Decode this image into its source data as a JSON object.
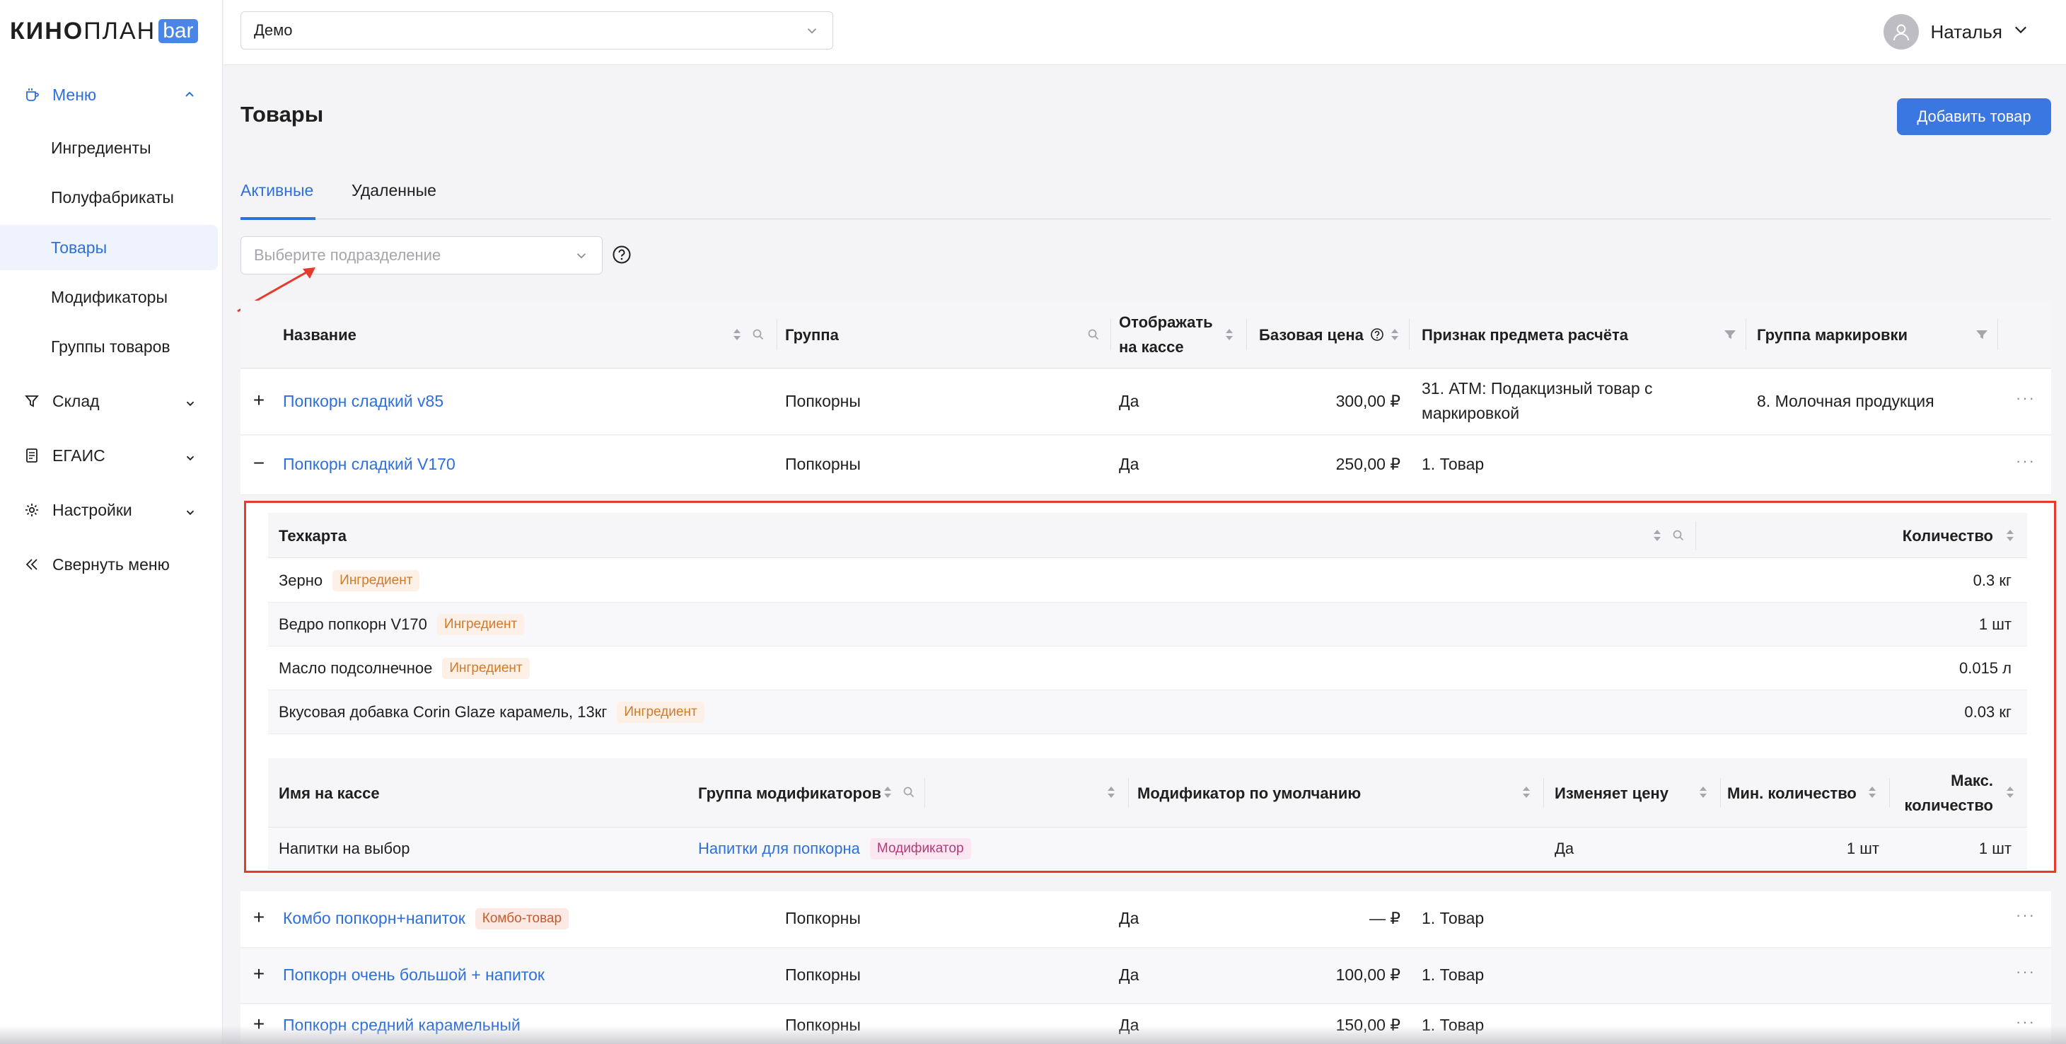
{
  "logo": {
    "prefix": "КИНО",
    "main": "ПЛАН",
    "badge": "bar"
  },
  "sidebar": {
    "menu_label": "Меню",
    "sub_items": [
      {
        "label": "Ингредиенты"
      },
      {
        "label": "Полуфабрикаты"
      },
      {
        "label": "Товары"
      },
      {
        "label": "Модификаторы"
      },
      {
        "label": "Группы товаров"
      }
    ],
    "main_items": [
      {
        "label": "Склад",
        "icon": "funnel-icon"
      },
      {
        "label": "ЕГАИС",
        "icon": "document-icon"
      },
      {
        "label": "Настройки",
        "icon": "gear-icon"
      },
      {
        "label": "Свернуть меню",
        "icon": "double-chevron-left-icon"
      }
    ],
    "active_item": "Товары"
  },
  "header": {
    "cinema_select": "Демо",
    "user_name": "Наталья"
  },
  "page": {
    "title": "Товары",
    "add_button": "Добавить товар",
    "tabs": [
      {
        "label": "Активные"
      },
      {
        "label": "Удаленные"
      }
    ],
    "subdivision_placeholder": "Выберите подразделение"
  },
  "colors": {
    "accent": "#3b77e0",
    "highlight_border": "#e53a2e",
    "arrow": "#e53a2e"
  },
  "table": {
    "columns": {
      "name": "Название",
      "group": "Группа",
      "show_line1": "Отображать",
      "show_line2": "на кассе",
      "price": "Базовая цена",
      "sign": "Признак предмета расчёта",
      "marking": "Группа маркировки"
    },
    "rows": [
      {
        "expander": "+",
        "name": "Попкорн сладкий v85",
        "badge": "",
        "group": "Попкорны",
        "show": "Да",
        "price": "300,00 ₽",
        "sign_line1": "31. АТМ: Подакцизный товар с",
        "sign_line2": "маркировкой",
        "marking": "8. Молочная продукция"
      },
      {
        "expander": "−",
        "name": "Попкорн сладкий V170",
        "badge": "",
        "group": "Попкорны",
        "show": "Да",
        "price": "250,00 ₽",
        "sign_line1": "1. Товар",
        "sign_line2": "",
        "marking": ""
      },
      {
        "expander": "+",
        "name": "Комбо попкорн+напиток",
        "badge": "Комбо-товар",
        "group": "Попкорны",
        "show": "Да",
        "price": "— ₽",
        "sign_line1": "1. Товар",
        "sign_line2": "",
        "marking": ""
      },
      {
        "expander": "+",
        "name": "Попкорн очень большой + напиток",
        "badge": "",
        "group": "Попкорны",
        "show": "Да",
        "price": "100,00 ₽",
        "sign_line1": "1. Товар",
        "sign_line2": "",
        "marking": ""
      },
      {
        "expander": "+",
        "name": "Попкорн средний карамельный",
        "badge": "",
        "group": "Попкорны",
        "show": "Да",
        "price": "150,00 ₽",
        "sign_line1": "1. Товар",
        "sign_line2": "",
        "marking": ""
      }
    ]
  },
  "techcard": {
    "col_name": "Техкарта",
    "col_qty": "Количество",
    "items": [
      {
        "name": "Зерно",
        "type": "Ингредиент",
        "qty": "0.3 кг"
      },
      {
        "name": "Ведро попкорн V170",
        "type": "Ингредиент",
        "qty": "1 шт"
      },
      {
        "name": "Масло подсолнечное",
        "type": "Ингредиент",
        "qty": "0.015 л"
      },
      {
        "name": "Вкусовая добавка Corin Glaze карамель, 13кг",
        "type": "Ингредиент",
        "qty": "0.03 кг"
      }
    ]
  },
  "modifiers": {
    "columns": {
      "cash_name": "Имя на кассе",
      "group": "Группа модификаторов",
      "default": "Модификатор по умолчанию",
      "changes_price": "Изменяет цену",
      "min_qty": "Мин. количество",
      "max_qty_line1": "Макс.",
      "max_qty_line2": "количество"
    },
    "rows": [
      {
        "cash_name": "Напитки на выбор",
        "group": "Напитки для попкорна",
        "type": "Модификатор",
        "default": "",
        "changes_price": "Да",
        "min_qty": "1 шт",
        "max_qty": "1 шт"
      }
    ]
  }
}
